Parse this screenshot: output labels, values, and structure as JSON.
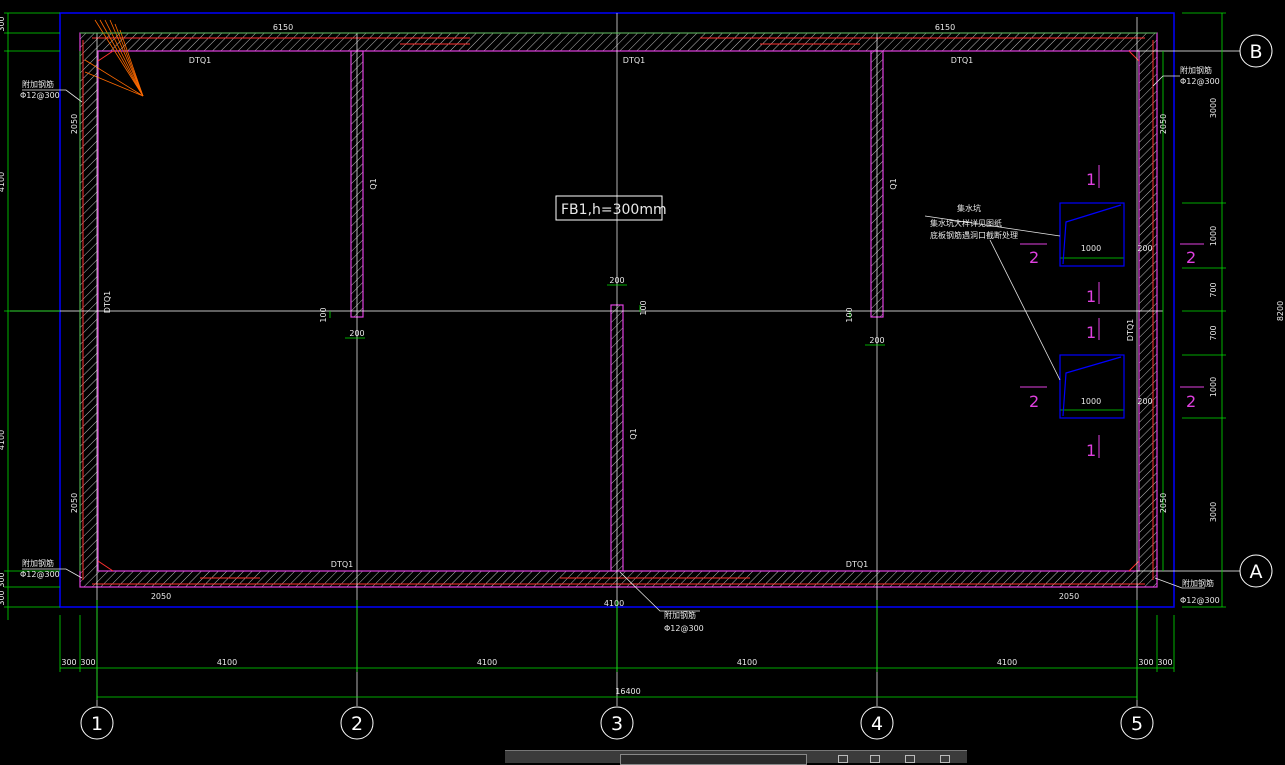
{
  "slab_label": "FB1,h=300mm",
  "axes": {
    "columns": [
      "1",
      "2",
      "3",
      "4",
      "5"
    ],
    "rows": [
      "B",
      "A"
    ]
  },
  "dims": {
    "top_bays": [
      "6150",
      "6150"
    ],
    "bottom_bays": [
      "4100",
      "4100",
      "4100",
      "4100"
    ],
    "bottom_edges": [
      "300",
      "300",
      "300",
      "300"
    ],
    "overall": "16400",
    "left_total": "4100",
    "left_top": "300",
    "left_bottom": [
      "300",
      "300"
    ],
    "side_2050": "2050",
    "right_segments": [
      "3000",
      "1000",
      "700",
      "700",
      "1000",
      "3000"
    ],
    "right_overall": "8200",
    "center_bottom": "4100",
    "bottom_2050": "2050",
    "opening_width": "1000",
    "opening_side": "200",
    "wall_thk": "200",
    "wall_offset": "100"
  },
  "labels": {
    "dtq": "DTQ1",
    "q1": "Q1",
    "rebar_title": "附加钢筋",
    "rebar_spec": "Φ12@300",
    "pit_title": "集水坑",
    "pit_note1": "集水坑大样详见图纸",
    "pit_note2": "底板钢筋遇洞口截断处理",
    "sec_1": "1",
    "sec_2": "2"
  },
  "statusbar": {
    "visible": true
  },
  "colors": {
    "background": "#000000",
    "wall_outline": "#e040e0",
    "hatch": "#c0c0c0",
    "rebar": "#ff3030",
    "grid_line": "#ffffff",
    "dimension": "#00ff00",
    "border": "#0000ff",
    "label_text": "#e8e8e8",
    "section_mark": "#e040e0",
    "leader_orange": "#ff6a00"
  }
}
